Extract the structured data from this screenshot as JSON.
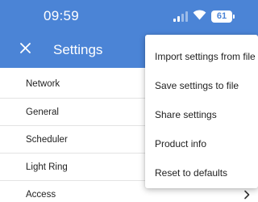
{
  "status_bar": {
    "time": "09:59",
    "battery_level": "61",
    "signal_icon": "signal-bars-icon",
    "wifi_icon": "wifi-icon",
    "battery_icon": "battery-icon"
  },
  "app_bar": {
    "title": "Settings",
    "close_icon": "close-icon",
    "background_color": "#4b84d6"
  },
  "settings": {
    "items": [
      {
        "label": "Network"
      },
      {
        "label": "General"
      },
      {
        "label": "Scheduler"
      },
      {
        "label": "Light Ring"
      },
      {
        "label": "Access"
      }
    ]
  },
  "overflow_menu": {
    "items": [
      {
        "label": "Import settings from file"
      },
      {
        "label": "Save settings to file"
      },
      {
        "label": "Share settings"
      },
      {
        "label": "Product info"
      },
      {
        "label": "Reset to defaults"
      }
    ]
  }
}
